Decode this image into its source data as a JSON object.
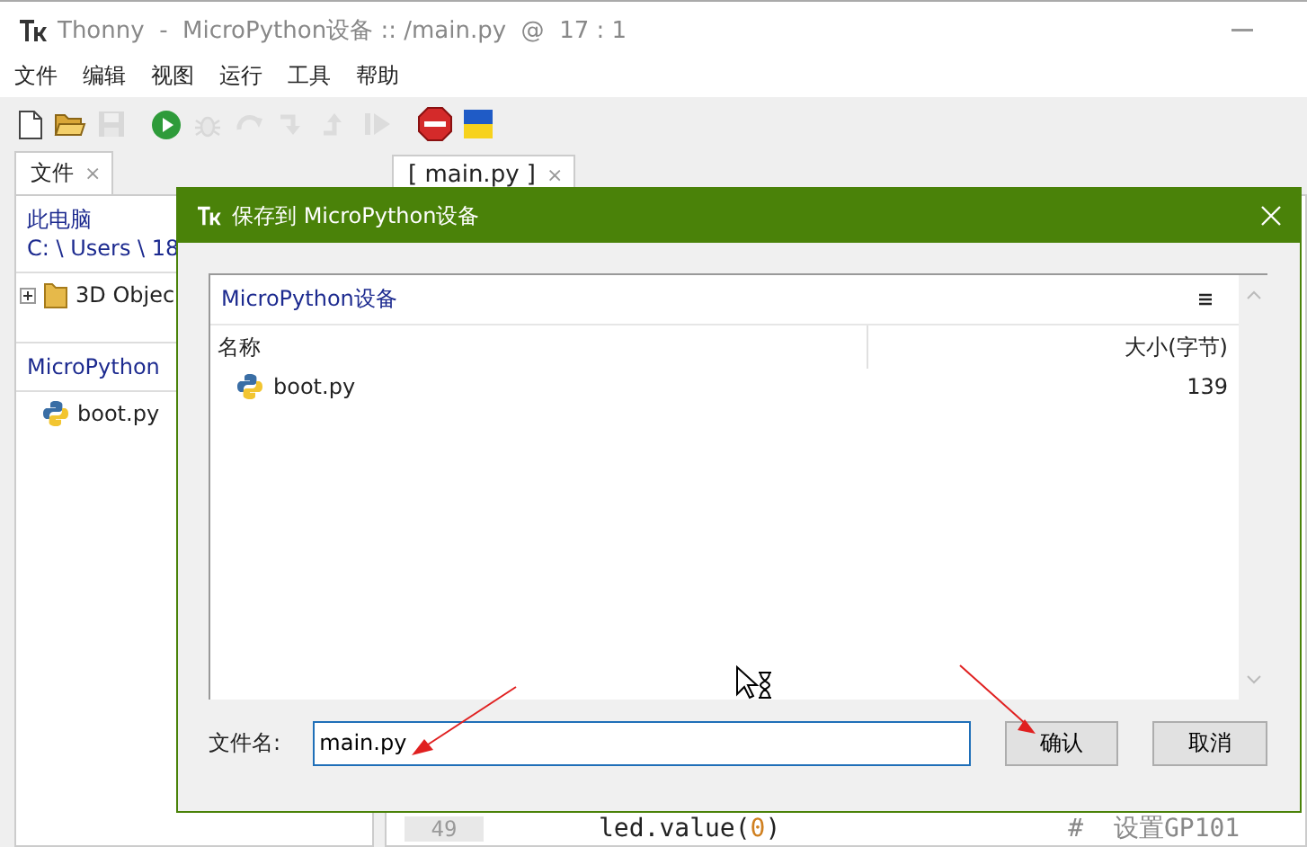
{
  "window": {
    "title": "Thonny  -  MicroPython设备 :: /main.py  @  17 : 1"
  },
  "menu": [
    "文件",
    "编辑",
    "视图",
    "运行",
    "工具",
    "帮助"
  ],
  "toolbar": [
    {
      "kind": "new",
      "disabled": false
    },
    {
      "kind": "open",
      "disabled": false
    },
    {
      "kind": "save",
      "disabled": true
    },
    {
      "kind": "run",
      "disabled": false
    },
    {
      "kind": "debug",
      "disabled": true
    },
    {
      "kind": "step-over",
      "disabled": true
    },
    {
      "kind": "step-into",
      "disabled": true
    },
    {
      "kind": "step-out",
      "disabled": true
    },
    {
      "kind": "resume",
      "disabled": true
    },
    {
      "kind": "stop",
      "disabled": false
    },
    {
      "kind": "flag",
      "disabled": false
    }
  ],
  "files_panel": {
    "tab": {
      "label": "文件",
      "close": "×"
    },
    "this_pc": "此电脑",
    "path": "C: \\ Users \\ 18",
    "tree": [
      {
        "label": "3D Objec",
        "expanded": false
      }
    ],
    "device_header": "MicroPython",
    "device_files": [
      "boot.py"
    ]
  },
  "editor": {
    "tab": {
      "label": "[ main.py ]",
      "close": "×"
    },
    "lines": [
      {
        "number": "49",
        "code": [
          {
            "text": "led.value(",
            "kind": "plain"
          },
          {
            "text": "0",
            "kind": "number"
          },
          {
            "text": ")",
            "kind": "plain"
          }
        ],
        "comment": "#  设置GP101"
      }
    ]
  },
  "dialog": {
    "title": "保存到 MicroPython设备",
    "location": "MicroPython设备",
    "columns": [
      "名称",
      "大小(字节)"
    ],
    "rows": [
      {
        "name": "boot.py",
        "size": "139"
      }
    ],
    "filename_label": "文件名:",
    "filename": "main.py",
    "buttons": [
      "确认",
      "取消"
    ]
  }
}
